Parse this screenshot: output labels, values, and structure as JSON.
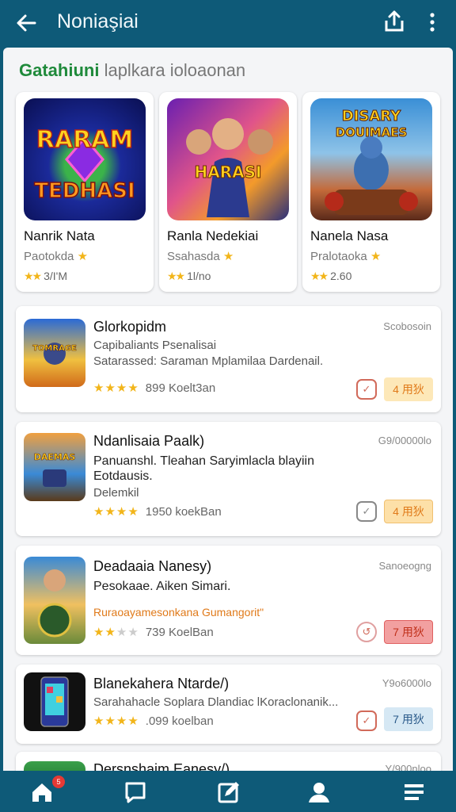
{
  "header": {
    "title": "Noniaşiai"
  },
  "section": {
    "title_bold": "Gatahiuni",
    "title_rest": " laplkara ioloaonan"
  },
  "featured": [
    {
      "name": "Nanrik Nata",
      "developer": "Paotokda",
      "stars": "★★",
      "rating_text": "3/I'M",
      "art_text": "RARAM TEDHASI"
    },
    {
      "name": "Ranla Nedekiai",
      "developer": "Ssahasda",
      "stars": "★★",
      "rating_text": "1l/no",
      "art_text": "HARASI"
    },
    {
      "name": "Nanela Nasa",
      "developer": "Pralotaoka",
      "stars": "★★",
      "rating_text": "2.60",
      "art_text": "DISARY DOUIMAES"
    }
  ],
  "list": [
    {
      "name": "Glorkopidm",
      "date": "Scobosoin",
      "desc1": "Capibaliants Psenalisai",
      "desc2": "Satarassed: Saraman Mplamilaa Dardenail.",
      "stars": "★★★★",
      "reviews": "899 Koelt3an",
      "button": "4 用狄"
    },
    {
      "name": "Ndanlisaia Paalk)",
      "date": "G9/00000lo",
      "desc1": "Panuanshl. Tleahan Saryimlacla blayiin Eotdausis.",
      "desc2": "Delemkil",
      "stars": "★★★★",
      "reviews": "1950 koekBan",
      "button": "4 用狄"
    },
    {
      "name": "Deadaaia Nanesy)",
      "date": "Sanoeogng",
      "desc1": "Pesokaae. Aiken Simari.",
      "promo": "Ruraoayamesonkana Gumangorit\"",
      "stars": "★★",
      "stars_off": "★★",
      "reviews": "739 KoelBan",
      "button": "7 用狄"
    },
    {
      "name": "Blanekahera Ntarde/)",
      "date": "Y9o6000lo",
      "desc1": "Sarahahacle Soplara Dlandiac lKoraclonanik...",
      "stars": "★★★★",
      "reviews": ".099 koelban",
      "button": "7 用狄"
    },
    {
      "name": "Dersnshaim Eanesy/)",
      "date": "Y/900nloo"
    }
  ],
  "nav": {
    "badge": "5"
  },
  "colors": {
    "primary": "#0e5a78",
    "accent_green": "#1f8a3b",
    "star": "#f2b51a"
  }
}
